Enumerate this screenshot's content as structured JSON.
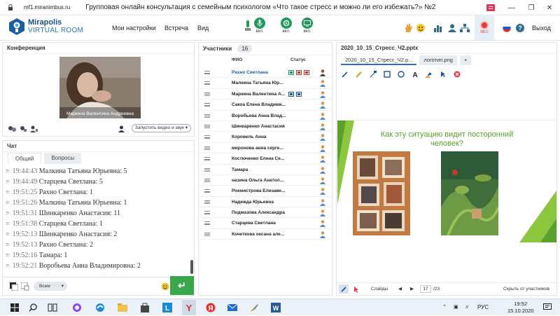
{
  "browser": {
    "url": "mf1.miranimbus.ru",
    "title": "Групповая онлайн консультация с семейным психологом «Что такое стресс и можно ли его избежать?» №2"
  },
  "header": {
    "logo_line1": "Mirapolis",
    "logo_line2": "VIRTUAL ROOM",
    "menu": [
      "Мои настройки",
      "Встреча",
      "Вид"
    ],
    "controls": [
      "вкл.",
      "вкл.",
      "вкл."
    ],
    "rec_label": "REC",
    "exit_label": "Выход"
  },
  "conference": {
    "title": "Конференция",
    "video_name": "Маркина Валентина  Андреевна",
    "start_video_label": "Запустить видео и звук"
  },
  "chat": {
    "title": "Чат",
    "tabs": [
      "Общий",
      "Вопросы"
    ],
    "messages": [
      {
        "time": "19:44:43",
        "text": "Малкина Татьяна  Юрьевна: 5"
      },
      {
        "time": "19:44:49",
        "text": "Старцева Светлана: 5"
      },
      {
        "time": "19:51:25",
        "text": "Рахно Светлана: 1"
      },
      {
        "time": "19:51:26",
        "text": "Малкина Татьяна  Юрьевна: 1"
      },
      {
        "time": "19:51:31",
        "text": "Шинкаренко  Анастасия: 11"
      },
      {
        "time": "19:51:38",
        "text": "Старцева Светлана: 1"
      },
      {
        "time": "19:52:13",
        "text": "Шинкаренко  Анастасия: 2"
      },
      {
        "time": "19:52:13",
        "text": "Рахно Светлана: 2"
      },
      {
        "time": "19:52:16",
        "text": "Тамара: 1"
      },
      {
        "time": "19:52:21",
        "text": "Воробьева Анна  Владимировна: 2"
      }
    ],
    "recipient": "Всем",
    "input_value": ""
  },
  "participants": {
    "title": "Участники",
    "count": "16",
    "col_name": "ФИО",
    "col_status": "Статус",
    "list": [
      "Рахно Светлана",
      "Малкина Татьяна  Юр...",
      "Маркина Валентина  А...",
      "Сакоа Елена Владими...",
      "Воробьева Анна  Влад...",
      "Шинкаренко  Анастасия",
      "Коровель Анна",
      "миронова  анна  серге...",
      "Костюченко  Елена Се...",
      "Тамара",
      "назина  Ольга Анатол...",
      "Рокмистрова  Елизаве...",
      "Надежда  Юрьевна",
      "Подмазова Александра",
      "Старцева Светлана",
      "Кочеткова  оксана але..."
    ]
  },
  "presentation": {
    "title": "2020_10_15_Стресс_Ч2.pptx",
    "tabs": [
      "2020_10_15_Стресс_Ч2.р...",
      "логотип.png",
      "+"
    ],
    "slide_title_line1": "Как эту ситуацию видит посторонний",
    "slide_title_line2": "человек?",
    "slides_label": "Слайды",
    "current_slide": "17",
    "total_slides": "/23",
    "hide_label": "Скрыть от участников"
  },
  "taskbar": {
    "lang": "РУС",
    "time": "19:52",
    "date": "15.10.2020"
  }
}
